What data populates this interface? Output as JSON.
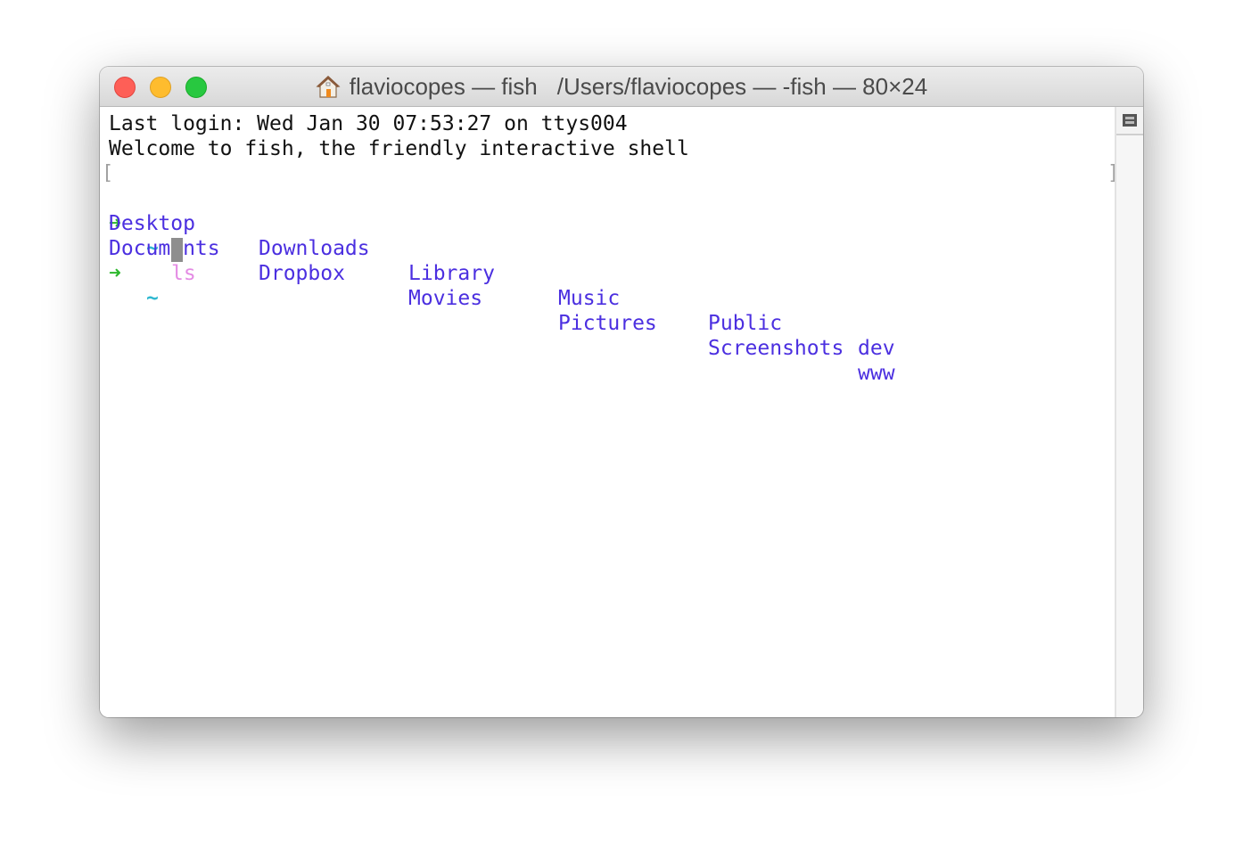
{
  "window": {
    "title_primary": "flaviocopes — fish",
    "title_secondary": "/Users/flaviocopes — -fish — 80×24",
    "title_icon": "home-icon",
    "controls": [
      "close",
      "minimize",
      "maximize"
    ]
  },
  "terminal": {
    "last_login": "Last login: Wed Jan 30 07:53:27 on ttys004",
    "welcome": "Welcome to fish, the friendly interactive shell",
    "prompt_arrow": "➜",
    "prompt_cwd": "~",
    "command": "ls",
    "open_bracket": "[",
    "close_bracket": "]",
    "ls_output": {
      "row1": [
        "Desktop",
        "Downloads",
        "Library",
        "Music",
        "Public",
        "dev"
      ],
      "row2": [
        "Documents",
        "Dropbox",
        "Movies",
        "Pictures",
        "Screenshots",
        "www"
      ]
    },
    "colors": {
      "arrow": "#2db82d",
      "tilde": "#2fb8d0",
      "command": "#e48be4",
      "directory": "#4b2fe0",
      "cursor": "#8e8e8e"
    }
  },
  "sidebar": {
    "split_button_icon": "split-pane-icon"
  }
}
